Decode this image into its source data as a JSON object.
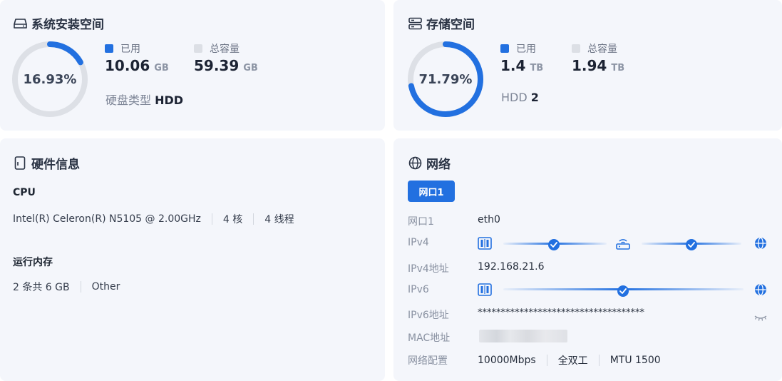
{
  "system_disk": {
    "title": "系统安装空间",
    "percent": "16.93%",
    "percent_value": 0.1693,
    "used_label": "已用",
    "used_value": "10.06",
    "used_unit": "GB",
    "total_label": "总容量",
    "total_value": "59.39",
    "total_unit": "GB",
    "type_label": "硬盘类型",
    "type_value": "HDD"
  },
  "storage": {
    "title": "存储空间",
    "percent": "71.79%",
    "percent_value": 0.7179,
    "used_label": "已用",
    "used_value": "1.4",
    "used_unit": "TB",
    "total_label": "总容量",
    "total_value": "1.94",
    "total_unit": "TB",
    "disk_type": "HDD",
    "disk_count": "2"
  },
  "hardware": {
    "title": "硬件信息",
    "cpu_label": "CPU",
    "cpu_model": "Intel(R) Celeron(R) N5105 @ 2.00GHz",
    "cpu_cores": "4 核",
    "cpu_threads": "4 线程",
    "mem_label": "运行内存",
    "mem_summary": "2 条共 6 GB",
    "mem_type": "Other"
  },
  "network": {
    "title": "网络",
    "tab": "网口1",
    "port_label": "网口1",
    "port_value": "eth0",
    "ipv4_label": "IPv4",
    "ipv4_addr_label": "IPv4地址",
    "ipv4_addr": "192.168.21.6",
    "ipv6_label": "IPv6",
    "ipv6_addr_label": "IPv6地址",
    "ipv6_addr": "************************************",
    "mac_label": "MAC地址",
    "config_label": "网络配置",
    "speed": "10000Mbps",
    "duplex": "全双工",
    "mtu": "MTU 1500"
  },
  "colors": {
    "accent": "#2270e0",
    "track": "#dde0e6",
    "legend_total": "#dcdfe5",
    "card_bg": "#f4f6fb"
  },
  "icons": [
    "hard-drive-icon",
    "server-icon",
    "device-icon",
    "globe-icon",
    "nas-device-icon",
    "router-icon",
    "check-icon",
    "eye-closed-icon"
  ]
}
